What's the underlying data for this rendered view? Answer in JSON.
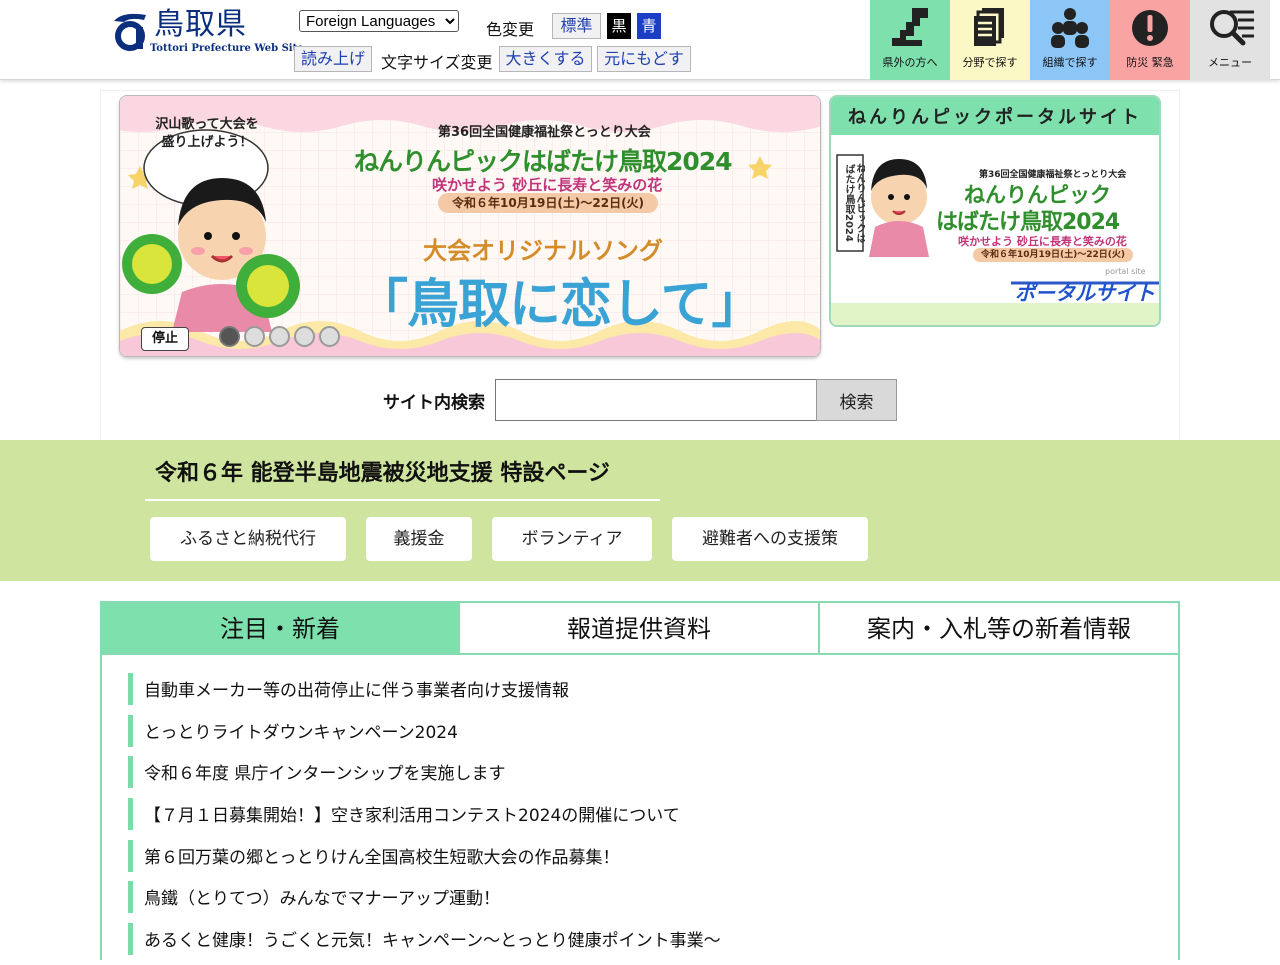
{
  "header": {
    "logo": {
      "name": "鳥取県",
      "subtitle": "Tottori Prefecture Web Site"
    },
    "language_select": {
      "selected": "Foreign Languages"
    },
    "color_change_label": "色変更",
    "color_buttons": [
      {
        "label": "標準",
        "bg": "#f1f1f3",
        "fg": "#1d3fb0"
      },
      {
        "label": "黒",
        "bg": "#000000",
        "fg": "#ffffff"
      },
      {
        "label": "青",
        "bg": "#1c3ec4",
        "fg": "#ffffff"
      }
    ],
    "read_aloud": "読み上げ",
    "font_size_label": "文字サイズ変更",
    "font_larger": "大きくする",
    "font_reset": "元にもどす",
    "nav_tiles": [
      {
        "label": "県外の方へ",
        "icon": "map-icon",
        "bg": "#7ee0ad"
      },
      {
        "label": "分野で探す",
        "icon": "documents-icon",
        "bg": "#fcf8c6"
      },
      {
        "label": "組織で探す",
        "icon": "people-icon",
        "bg": "#8cc6f7"
      },
      {
        "label": "防災 緊急",
        "icon": "alert-icon",
        "bg": "#f9a3a3"
      },
      {
        "label": "メニュー",
        "icon": "menu-search-icon",
        "bg": "#e2e2e2"
      }
    ]
  },
  "slider": {
    "bubble_line1": "沢山歌って大会を",
    "bubble_line2": "盛り上げよう！",
    "event_top": "第36回全国健康福祉祭とっとり大会",
    "event_title": "ねんりんピックはばたけ鳥取2024",
    "event_slogan": "咲かせよう 砂丘に長寿と笑みの花",
    "event_dates": "令和６年10月19日(土)〜22日(火)",
    "song_label": "大会オリジナルソング",
    "song_title": "「鳥取に恋して」",
    "stop_label": "停止",
    "dot_count": 5,
    "active_dot": 1
  },
  "portal": {
    "heading": "ねんりんピックポータルサイト",
    "event_top": "第36回全国健康福祉祭とっとり大会",
    "title_line1": "ねんりんピック",
    "title_line2": "はばたけ鳥取2024",
    "slogan": "咲かせよう 砂丘に長寿と笑みの花",
    "dates": "令和６年10月19日(土)〜22日(火)",
    "banner": "ねんりんピックはばたけ鳥取2024",
    "portal_small": "portal site",
    "portal_label": "ポータルサイト"
  },
  "search": {
    "label": "サイト内検索",
    "value": "",
    "button": "検索"
  },
  "noto": {
    "title": "令和６年 能登半島地震被災地支援 特設ページ",
    "buttons": [
      "ふるさと納税代行",
      "義援金",
      "ボランティア",
      "避難者への支援策"
    ]
  },
  "news": {
    "tabs": [
      {
        "label": "注目・新着",
        "active": true
      },
      {
        "label": "報道提供資料",
        "active": false
      },
      {
        "label": "案内・入札等の新着情報",
        "active": false
      }
    ],
    "items": [
      "自動車メーカー等の出荷停止に伴う事業者向け支援情報",
      "とっとりライトダウンキャンペーン2024",
      "令和６年度 県庁インターンシップを実施します",
      "【７月１日募集開始！】空き家利活用コンテスト2024の開催について",
      "第６回万葉の郷とっとりけん全国高校生短歌大会の作品募集！",
      "鳥鐵（とりてつ）みんなでマナーアップ運動！",
      "あるくと健康！うごくと元気！キャンペーン～とっとり健康ポイント事業～"
    ]
  },
  "colors": {
    "accent_green": "#7ee0ad",
    "noto_bg": "#cfe59f",
    "link_blue": "#1d3fb0",
    "logo_blue": "#0b2f7d"
  }
}
